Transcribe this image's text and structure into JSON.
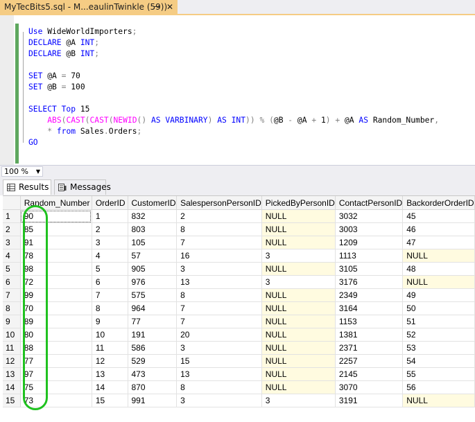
{
  "tab": {
    "title": "MyTecBits5.sql - M...eaulinTwinkle (59))",
    "pin_icon": "pin-icon",
    "close_icon": "close-icon"
  },
  "editor": {
    "lines": [
      {
        "parts": [
          {
            "t": "Use",
            "c": "kw"
          },
          {
            "t": " WideWorldImporters",
            "c": ""
          },
          {
            "t": ";",
            "c": "op"
          }
        ]
      },
      {
        "parts": [
          {
            "t": "DECLARE",
            "c": "kw"
          },
          {
            "t": " @A ",
            "c": ""
          },
          {
            "t": "INT",
            "c": "kw"
          },
          {
            "t": ";",
            "c": "op"
          }
        ]
      },
      {
        "parts": [
          {
            "t": "DECLARE",
            "c": "kw"
          },
          {
            "t": " @B ",
            "c": ""
          },
          {
            "t": "INT",
            "c": "kw"
          },
          {
            "t": ";",
            "c": "op"
          }
        ]
      },
      {
        "parts": []
      },
      {
        "parts": [
          {
            "t": "SET",
            "c": "kw"
          },
          {
            "t": " @A ",
            "c": ""
          },
          {
            "t": "=",
            "c": "op"
          },
          {
            "t": " 70",
            "c": ""
          }
        ]
      },
      {
        "parts": [
          {
            "t": "SET",
            "c": "kw"
          },
          {
            "t": " @B ",
            "c": ""
          },
          {
            "t": "=",
            "c": "op"
          },
          {
            "t": " 100",
            "c": ""
          }
        ]
      },
      {
        "parts": []
      },
      {
        "parts": [
          {
            "t": "SELECT",
            "c": "kw"
          },
          {
            "t": " ",
            "c": ""
          },
          {
            "t": "Top",
            "c": "kw"
          },
          {
            "t": " 15",
            "c": ""
          }
        ]
      },
      {
        "parts": [
          {
            "t": "    ",
            "c": ""
          },
          {
            "t": "ABS",
            "c": "fn"
          },
          {
            "t": "(",
            "c": "op"
          },
          {
            "t": "CAST",
            "c": "fn"
          },
          {
            "t": "(",
            "c": "op"
          },
          {
            "t": "CAST",
            "c": "fn"
          },
          {
            "t": "(",
            "c": "op"
          },
          {
            "t": "NEWID",
            "c": "fn"
          },
          {
            "t": "()",
            "c": "op"
          },
          {
            "t": " ",
            "c": ""
          },
          {
            "t": "AS",
            "c": "kw"
          },
          {
            "t": " ",
            "c": ""
          },
          {
            "t": "VARBINARY",
            "c": "kw"
          },
          {
            "t": ")",
            "c": "op"
          },
          {
            "t": " ",
            "c": ""
          },
          {
            "t": "AS",
            "c": "kw"
          },
          {
            "t": " ",
            "c": ""
          },
          {
            "t": "INT",
            "c": "kw"
          },
          {
            "t": "))",
            "c": "op"
          },
          {
            "t": " ",
            "c": ""
          },
          {
            "t": "%",
            "c": "op"
          },
          {
            "t": " ",
            "c": ""
          },
          {
            "t": "(",
            "c": "op"
          },
          {
            "t": "@B ",
            "c": ""
          },
          {
            "t": "-",
            "c": "op"
          },
          {
            "t": " @A ",
            "c": ""
          },
          {
            "t": "+",
            "c": "op"
          },
          {
            "t": " 1",
            "c": ""
          },
          {
            "t": ")",
            "c": "op"
          },
          {
            "t": " ",
            "c": ""
          },
          {
            "t": "+",
            "c": "op"
          },
          {
            "t": " @A ",
            "c": ""
          },
          {
            "t": "AS",
            "c": "kw"
          },
          {
            "t": " Random_Number",
            "c": ""
          },
          {
            "t": ",",
            "c": "op"
          }
        ]
      },
      {
        "parts": [
          {
            "t": "    ",
            "c": ""
          },
          {
            "t": "*",
            "c": "op"
          },
          {
            "t": " ",
            "c": ""
          },
          {
            "t": "from",
            "c": "kw"
          },
          {
            "t": " Sales",
            "c": ""
          },
          {
            "t": ".",
            "c": "op"
          },
          {
            "t": "Orders",
            "c": ""
          },
          {
            "t": ";",
            "c": "op"
          }
        ]
      },
      {
        "parts": [
          {
            "t": "GO",
            "c": "kw"
          }
        ]
      }
    ]
  },
  "zoom": {
    "value": "100 %"
  },
  "results_tabs": {
    "results": "Results",
    "messages": "Messages"
  },
  "grid": {
    "columns": [
      "Random_Number",
      "OrderID",
      "CustomerID",
      "SalespersonPersonID",
      "PickedByPersonID",
      "ContactPersonID",
      "BackorderOrderID"
    ],
    "rows": [
      [
        "1",
        "90",
        "1",
        "832",
        "2",
        "NULL",
        "3032",
        "45"
      ],
      [
        "2",
        "85",
        "2",
        "803",
        "8",
        "NULL",
        "3003",
        "46"
      ],
      [
        "3",
        "91",
        "3",
        "105",
        "7",
        "NULL",
        "1209",
        "47"
      ],
      [
        "4",
        "78",
        "4",
        "57",
        "16",
        "3",
        "1113",
        "NULL"
      ],
      [
        "5",
        "98",
        "5",
        "905",
        "3",
        "NULL",
        "3105",
        "48"
      ],
      [
        "6",
        "72",
        "6",
        "976",
        "13",
        "3",
        "3176",
        "NULL"
      ],
      [
        "7",
        "99",
        "7",
        "575",
        "8",
        "NULL",
        "2349",
        "49"
      ],
      [
        "8",
        "70",
        "8",
        "964",
        "7",
        "NULL",
        "3164",
        "50"
      ],
      [
        "9",
        "89",
        "9",
        "77",
        "7",
        "NULL",
        "1153",
        "51"
      ],
      [
        "10",
        "80",
        "10",
        "191",
        "20",
        "NULL",
        "1381",
        "52"
      ],
      [
        "11",
        "88",
        "11",
        "586",
        "3",
        "NULL",
        "2371",
        "53"
      ],
      [
        "12",
        "77",
        "12",
        "529",
        "15",
        "NULL",
        "2257",
        "54"
      ],
      [
        "13",
        "97",
        "13",
        "473",
        "13",
        "NULL",
        "2145",
        "55"
      ],
      [
        "14",
        "75",
        "14",
        "870",
        "8",
        "NULL",
        "3070",
        "56"
      ],
      [
        "15",
        "73",
        "15",
        "991",
        "3",
        "3",
        "3191",
        "NULL"
      ]
    ]
  },
  "colors": {
    "highlight": "#1fc21f",
    "null_bg": "#fffbe0",
    "tab_active": "#f5cc84"
  }
}
